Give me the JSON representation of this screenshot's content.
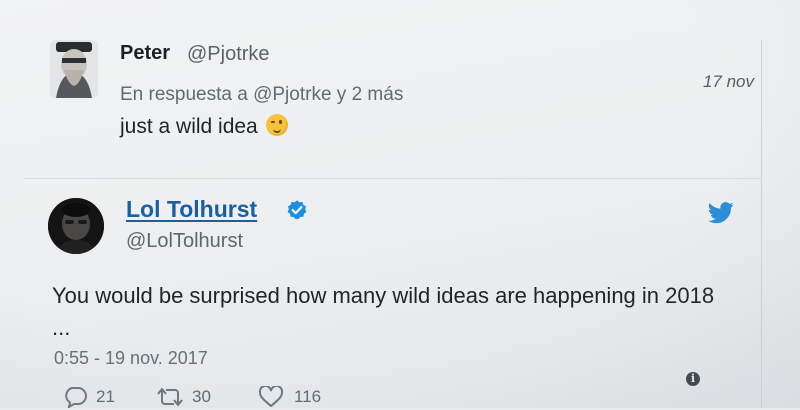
{
  "reply_tweet": {
    "name": "Peter",
    "handle": "@Pjotrke",
    "time": "17 nov",
    "context_prefix": "En respuesta a",
    "context_mention": "@Pjotrke",
    "context_suffix": "y 2 más",
    "text": "just a wild idea",
    "emoji": "winking-face-icon"
  },
  "main_tweet": {
    "name": "Lol Tolhurst",
    "handle": "@LolTolhurst",
    "verified": true,
    "text": "You would be surprised how many wild ideas are happening in 2018 ...",
    "date": "0:55 - 19 nov. 2017",
    "actions": {
      "reply_count": "21",
      "retweet_count": "30",
      "like_count": "116"
    }
  },
  "colors": {
    "link_blue": "#1b5f9e",
    "twitter_blue": "#1da1f2",
    "text_dark": "#1f2429",
    "text_muted": "#5f6a73"
  }
}
